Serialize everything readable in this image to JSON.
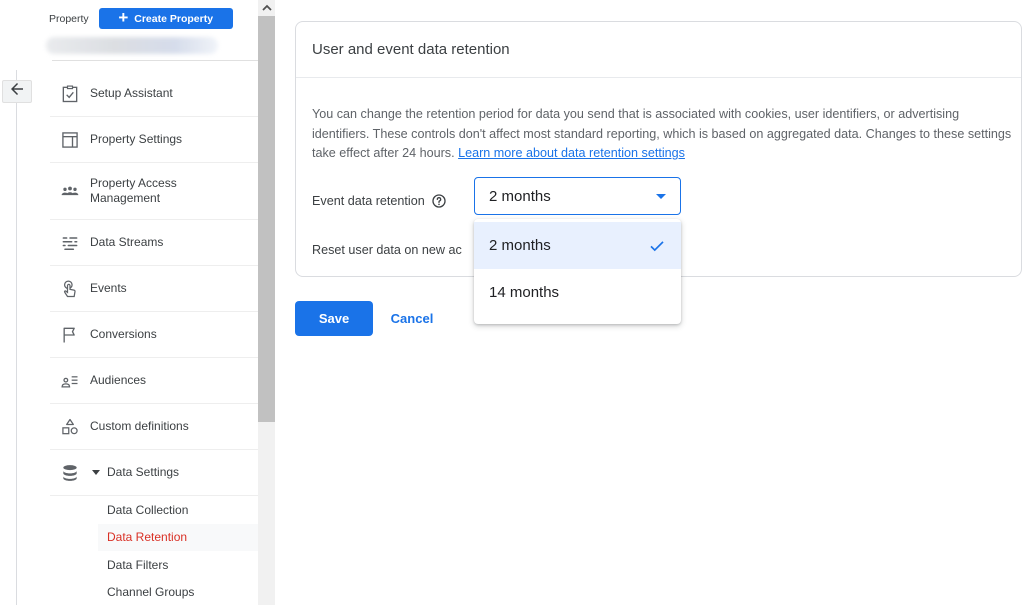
{
  "colors": {
    "accent": "#1a73e8",
    "active_nav": "#d93025",
    "selected_option_bg": "#e8f0fe"
  },
  "rail": {
    "back_icon": "arrow-left-icon"
  },
  "sidebar": {
    "property_label": "Property",
    "create_property_label": "Create Property",
    "create_property_icon": "plus-icon",
    "property_name": "(blurred)",
    "items": [
      {
        "label": "Setup Assistant",
        "icon": "clipboard-check-icon"
      },
      {
        "label": "Property Settings",
        "icon": "layout-icon"
      },
      {
        "label": "Property Access Management",
        "icon": "people-icon"
      },
      {
        "label": "Data Streams",
        "icon": "streams-icon"
      },
      {
        "label": "Events",
        "icon": "touch-icon"
      },
      {
        "label": "Conversions",
        "icon": "flag-icon"
      },
      {
        "label": "Audiences",
        "icon": "audience-icon"
      },
      {
        "label": "Custom definitions",
        "icon": "shapes-icon"
      },
      {
        "label": "Data Settings",
        "icon": "database-icon",
        "expanded": true
      }
    ],
    "sub_items": [
      {
        "label": "Data Collection",
        "active": false
      },
      {
        "label": "Data Retention",
        "active": true
      },
      {
        "label": "Data Filters",
        "active": false
      },
      {
        "label": "Channel Groups",
        "active": false
      }
    ]
  },
  "card": {
    "title": "User and event data retention",
    "description": "You can change the retention period for data you send that is associated with cookies, user identifiers, or advertising identifiers. These controls don't affect most standard reporting, which is based on aggregated data. Changes to these settings take effect after 24 hours.",
    "learn_more_link": "Learn more about data retention settings",
    "event_retention_label": "Event data retention",
    "help_icon": "help-circle-icon",
    "reset_label": "Reset user data on new ac",
    "select": {
      "value": "2 months",
      "options": [
        {
          "label": "2 months",
          "selected": true
        },
        {
          "label": "14 months",
          "selected": false
        }
      ]
    }
  },
  "actions": {
    "save_label": "Save",
    "cancel_label": "Cancel"
  }
}
